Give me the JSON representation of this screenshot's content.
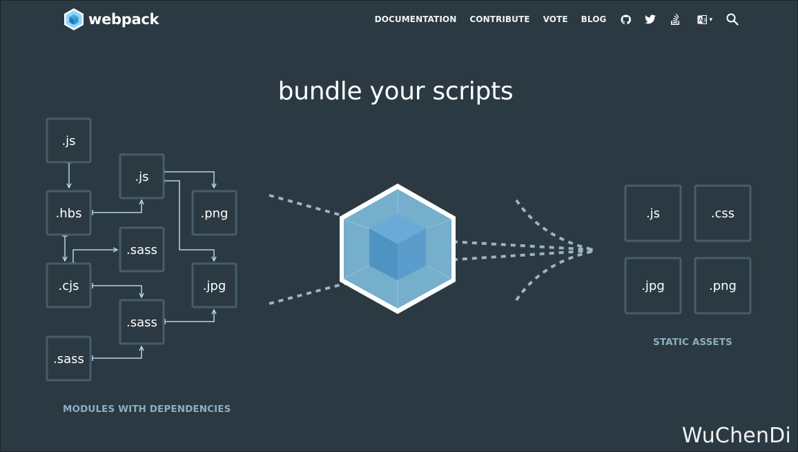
{
  "header": {
    "logo_text": "webpack",
    "nav": [
      "DOCUMENTATION",
      "CONTRIBUTE",
      "VOTE",
      "BLOG"
    ],
    "icons": [
      "github-icon",
      "twitter-icon",
      "stack-overflow-icon",
      "language-icon",
      "search-icon"
    ],
    "language_caret": "▾"
  },
  "hero": {
    "headline": "bundle your scripts"
  },
  "modules": {
    "items": [
      ".js",
      ".hbs",
      ".cjs",
      ".sass",
      ".js",
      ".sass",
      ".sass",
      ".png",
      ".jpg"
    ],
    "caption": "MODULES WITH DEPENDENCIES"
  },
  "assets": {
    "items": [
      ".js",
      ".css",
      ".jpg",
      ".png"
    ],
    "caption": "STATIC ASSETS"
  },
  "watermark": "WuChenDi",
  "colors": {
    "background": "#2b3a42",
    "box_border": "#465e69",
    "arrow": "#b4d5e5",
    "caption": "#8daec2",
    "cube_outer": "#75afcc",
    "cube_inner": "#5499c7",
    "dots": "#9cb5c1"
  }
}
